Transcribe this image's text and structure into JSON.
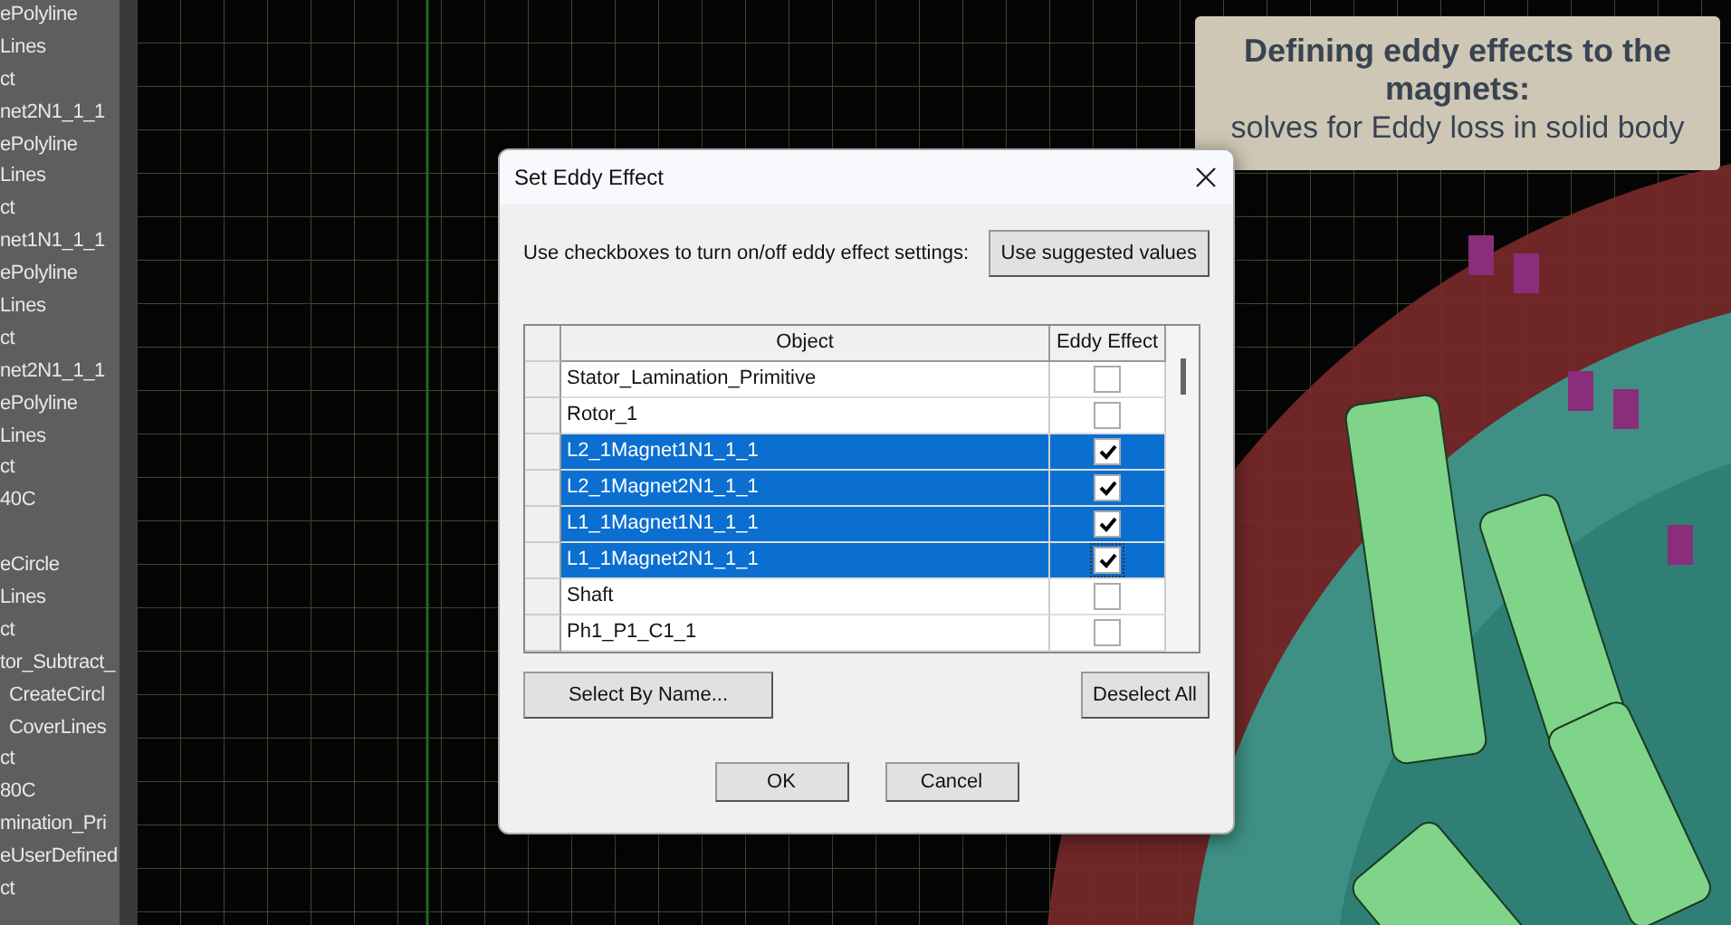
{
  "sidebar": {
    "items": [
      {
        "label": "ePolyline"
      },
      {
        "label": "Lines"
      },
      {
        "label": "ct"
      },
      {
        "label": "net2N1_1_1"
      },
      {
        "label": "ePolyline"
      },
      {
        "label": "Lines"
      },
      {
        "label": "ct"
      },
      {
        "label": "net1N1_1_1"
      },
      {
        "label": "ePolyline"
      },
      {
        "label": "Lines"
      },
      {
        "label": "ct"
      },
      {
        "label": "net2N1_1_1"
      },
      {
        "label": "ePolyline"
      },
      {
        "label": "Lines"
      },
      {
        "label": "ct"
      },
      {
        "label": "40C"
      },
      {
        "label": "eCircle"
      },
      {
        "label": "Lines"
      },
      {
        "label": "ct"
      },
      {
        "label": "tor_Subtract_",
        "children": [
          {
            "label": "CreateCircl"
          },
          {
            "label": "CoverLines"
          }
        ]
      },
      {
        "label": "ct"
      },
      {
        "label": "80C"
      },
      {
        "label": "mination_Pri"
      },
      {
        "label": "eUserDefined"
      },
      {
        "label": "ct"
      }
    ]
  },
  "annotation": {
    "title": "Defining eddy effects to the magnets:",
    "subtitle": "solves for Eddy loss in solid body"
  },
  "dialog": {
    "title": "Set Eddy Effect",
    "instruction": "Use checkboxes to turn on/off eddy effect settings:",
    "suggest_button": "Use suggested values",
    "table": {
      "columns": [
        "Object",
        "Eddy Effect"
      ],
      "rows": [
        {
          "name": "Stator_Lamination_Primitive",
          "selected": false,
          "checked": false,
          "focused": false
        },
        {
          "name": "Rotor_1",
          "selected": false,
          "checked": false,
          "focused": false
        },
        {
          "name": "L2_1Magnet1N1_1_1",
          "selected": true,
          "checked": true,
          "focused": false
        },
        {
          "name": "L2_1Magnet2N1_1_1",
          "selected": true,
          "checked": true,
          "focused": false
        },
        {
          "name": "L1_1Magnet1N1_1_1",
          "selected": true,
          "checked": true,
          "focused": false
        },
        {
          "name": "L1_1Magnet2N1_1_1",
          "selected": true,
          "checked": true,
          "focused": true
        },
        {
          "name": "Shaft",
          "selected": false,
          "checked": false,
          "focused": false
        },
        {
          "name": "Ph1_P1_C1_1",
          "selected": false,
          "checked": false,
          "focused": false
        }
      ]
    },
    "select_button": "Select By Name...",
    "deselect_button": "Deselect All",
    "ok_button": "OK",
    "cancel_button": "Cancel"
  }
}
